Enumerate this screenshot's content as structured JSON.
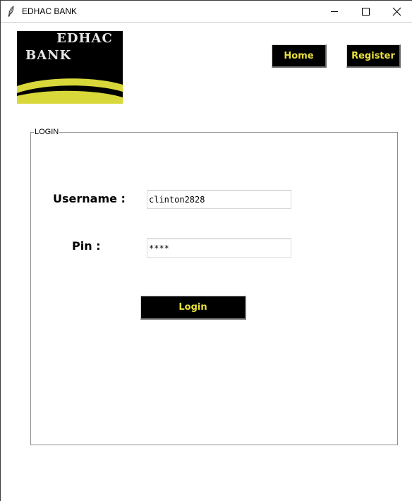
{
  "window": {
    "title": "EDHAC BANK",
    "icon": "feather-icon",
    "controls": [
      "minimize-icon",
      "maximize-icon",
      "close-icon"
    ]
  },
  "logo": {
    "line1": "EDHAC",
    "line2": "BANK",
    "colors": {
      "background": "#000000",
      "swoosh": "#d8d83a",
      "text": "#e6e6e6"
    }
  },
  "nav": {
    "home_label": "Home",
    "register_label": "Register"
  },
  "login": {
    "frame_label": "LOGIN",
    "username_label": "Username :",
    "username_value": "clinton2828",
    "pin_label": "Pin :",
    "pin_value": "****",
    "login_button": "Login"
  },
  "colors": {
    "button_bg": "#000000",
    "button_text": "#e8e03a"
  }
}
